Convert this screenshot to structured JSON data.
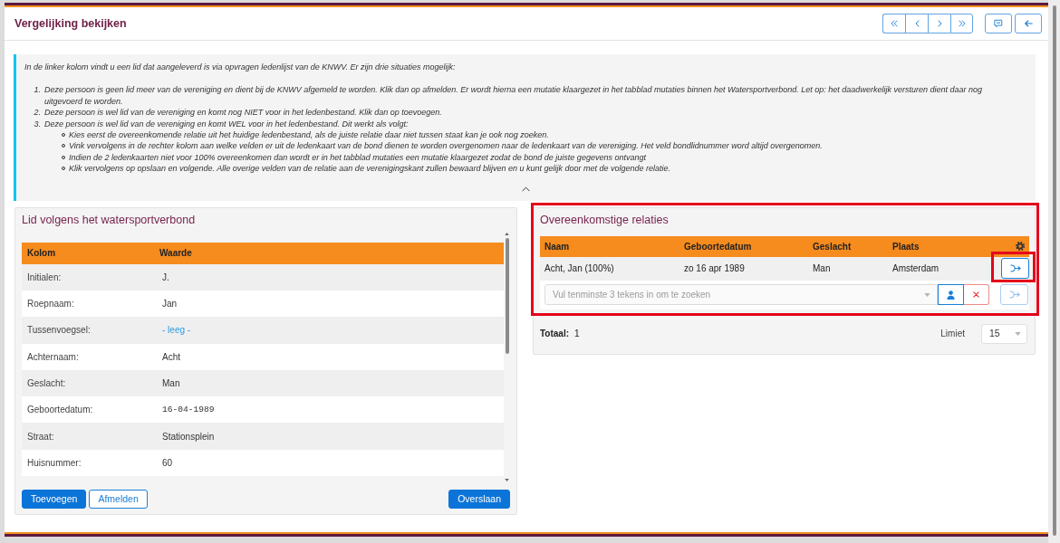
{
  "header": {
    "title": "Vergelijking bekijken"
  },
  "info": {
    "intro": "In de linker kolom vindt u een lid dat aangeleverd is via opvragen ledenlijst van de KNWV. Er zijn drie situaties mogelijk:",
    "expanded": true,
    "steps": [
      {
        "number": "1.",
        "text": "Deze persoon is geen lid meer van de vereniging en dient bij de KNWV afgemeld te worden. Klik dan op afmelden. Er wordt hierna een mutatie klaargezet in het tabblad mutaties binnen het Watersportverbond. Let op: het daadwerkelijk versturen dient daar nog uitgevoerd te worden."
      },
      {
        "number": "2.",
        "text": "Deze persoon is wel lid van de vereniging en komt nog NIET voor in het ledenbestand. Klik dan op toevoegen."
      },
      {
        "number": "3.",
        "text": "Deze persoon is wel lid van de vereniging en komt WEL voor in het ledenbestand. Dit werkt als volgt:",
        "children": [
          {
            "text": "Kies eerst de overeenkomende relatie uit het huidige ledenbestand, als de juiste relatie daar niet tussen staat kan je ook nog zoeken."
          },
          {
            "text": "Vink vervolgens in de rechter kolom aan welke velden er uit de ledenkaart van de bond dienen te worden overgenomen naar de ledenkaart van de vereniging. Het veld bondlidnummer word altijd overgenomen."
          },
          {
            "text": "Indien de 2 ledenkaarten niet voor 100% overeenkomen dan wordt er in het tabblad mutaties een mutatie klaargezet zodat de bond de juiste gegevens ontvangt"
          },
          {
            "text": "Klik vervolgens op opslaan en volgende. Alle overige velden van de relatie aan de verenigingskant zullen bewaard blijven en u kunt gelijk door met de volgende relatie."
          }
        ]
      }
    ]
  },
  "member_panel": {
    "title": "Lid volgens het watersportverbond",
    "columns": [
      "Kolom",
      "Waarde"
    ],
    "rows": [
      {
        "label": "Initialen:",
        "value": "J.",
        "kind": "text"
      },
      {
        "label": "Roepnaam:",
        "value": "Jan",
        "kind": "text"
      },
      {
        "label": "Tussenvoegsel:",
        "value": "- leeg -",
        "kind": "empty"
      },
      {
        "label": "Achternaam:",
        "value": "Acht",
        "kind": "text"
      },
      {
        "label": "Geslacht:",
        "value": "Man",
        "kind": "text"
      },
      {
        "label": "Geboortedatum:",
        "value": "16-04-1989",
        "kind": "mono"
      },
      {
        "label": "Straat:",
        "value": "Stationsplein",
        "kind": "text"
      },
      {
        "label": "Huisnummer:",
        "value": "60",
        "kind": "text"
      }
    ],
    "actions_left": [
      {
        "label": "Toevoegen",
        "kind": "primary"
      },
      {
        "label": "Afmelden",
        "kind": "outline"
      }
    ],
    "actions_right": [
      {
        "label": "Overslaan",
        "kind": "primary"
      }
    ]
  },
  "relations": {
    "title": "Overeenkomstige relaties",
    "highlighted": true,
    "columns": [
      "Naam",
      "Geboortedatum",
      "Geslacht",
      "Plaats"
    ],
    "rows": [
      {
        "cells": [
          "Acht, Jan (100%)",
          "zo 16 apr 1989",
          "Man",
          "Amsterdam"
        ],
        "merge": {
          "disabled": false,
          "highlighted": true
        }
      }
    ],
    "search": {
      "placeholder": "Vul tenminste 3 tekens in om te zoeken",
      "merge": {
        "disabled": true
      }
    },
    "total_label": "Totaal:",
    "total": "1",
    "limit_label": "Limiet",
    "limit": "15"
  }
}
